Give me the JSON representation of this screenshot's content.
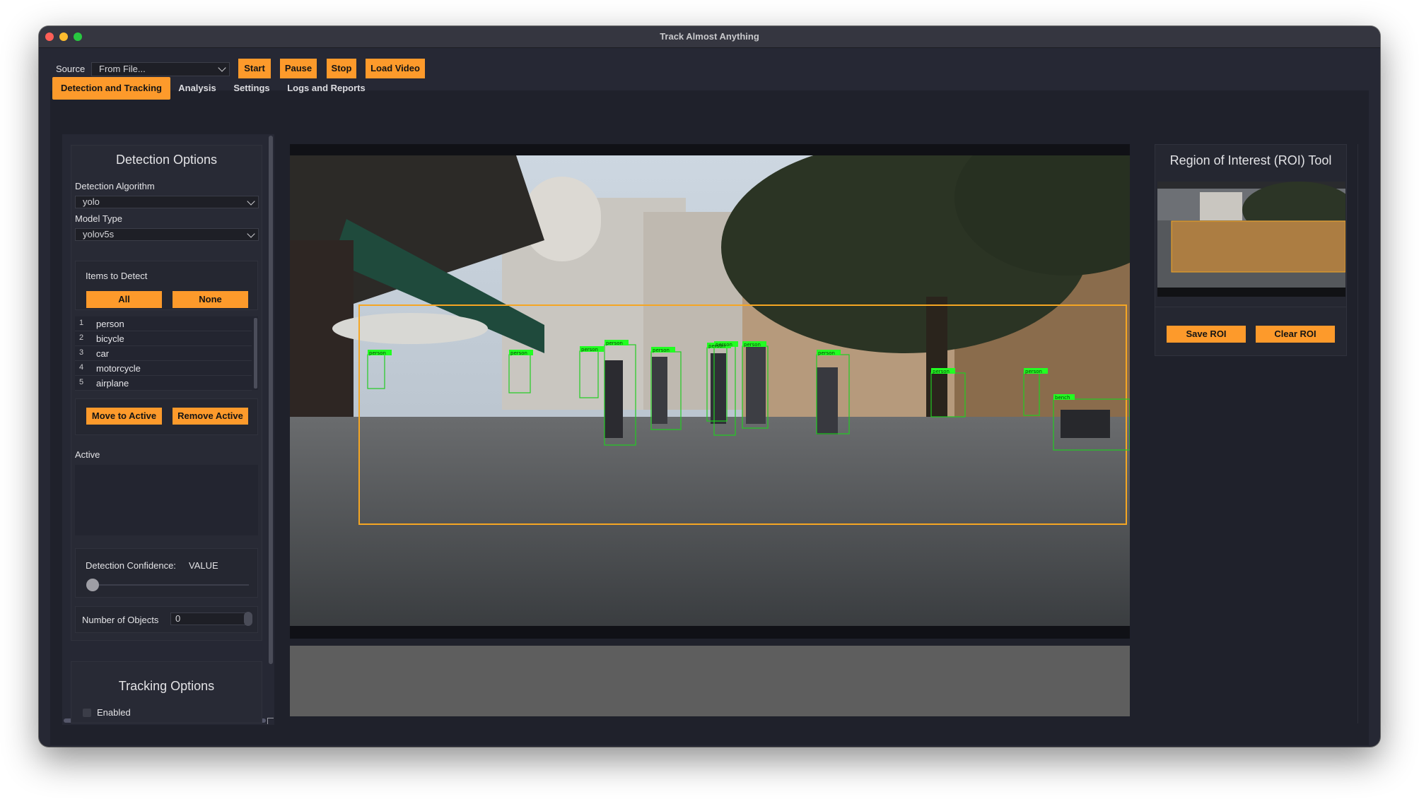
{
  "window": {
    "title": "Track Almost Anything"
  },
  "toolbar": {
    "source_label": "Source",
    "source_value": "From File...",
    "start": "Start",
    "pause": "Pause",
    "stop": "Stop",
    "load_video": "Load Video"
  },
  "tabs": [
    {
      "label": "Detection and Tracking",
      "active": true
    },
    {
      "label": "Analysis",
      "active": false
    },
    {
      "label": "Settings",
      "active": false
    },
    {
      "label": "Logs and Reports",
      "active": false
    }
  ],
  "detection": {
    "title": "Detection Options",
    "algorithm_label": "Detection Algorithm",
    "algorithm_value": "yolo",
    "model_label": "Model Type",
    "model_value": "yolov5s",
    "items_label": "Items to Detect",
    "all_button": "All",
    "none_button": "None",
    "items": [
      {
        "n": "1",
        "name": "person"
      },
      {
        "n": "2",
        "name": "bicycle"
      },
      {
        "n": "3",
        "name": "car"
      },
      {
        "n": "4",
        "name": "motorcycle"
      },
      {
        "n": "5",
        "name": "airplane"
      }
    ],
    "move_button": "Move to Active",
    "remove_button": "Remove Active",
    "active_label": "Active",
    "confidence_label": "Detection Confidence:",
    "confidence_value": "VALUE",
    "num_objects_label": "Number of Objects",
    "num_objects_value": "0"
  },
  "tracking": {
    "title": "Tracking Options",
    "enabled_label": "Enabled"
  },
  "roi": {
    "title": "Region of Interest (ROI) Tool",
    "save_button": "Save ROI",
    "clear_button": "Clear ROI"
  },
  "video": {
    "detections": [
      "person",
      "person",
      "person",
      "person",
      "person",
      "person",
      "person",
      "person",
      "person",
      "person",
      "person",
      "bench"
    ]
  },
  "colors": {
    "accent": "#fd9a2b",
    "detection_box": "#22ff22",
    "roi_box": "#f5a623"
  }
}
